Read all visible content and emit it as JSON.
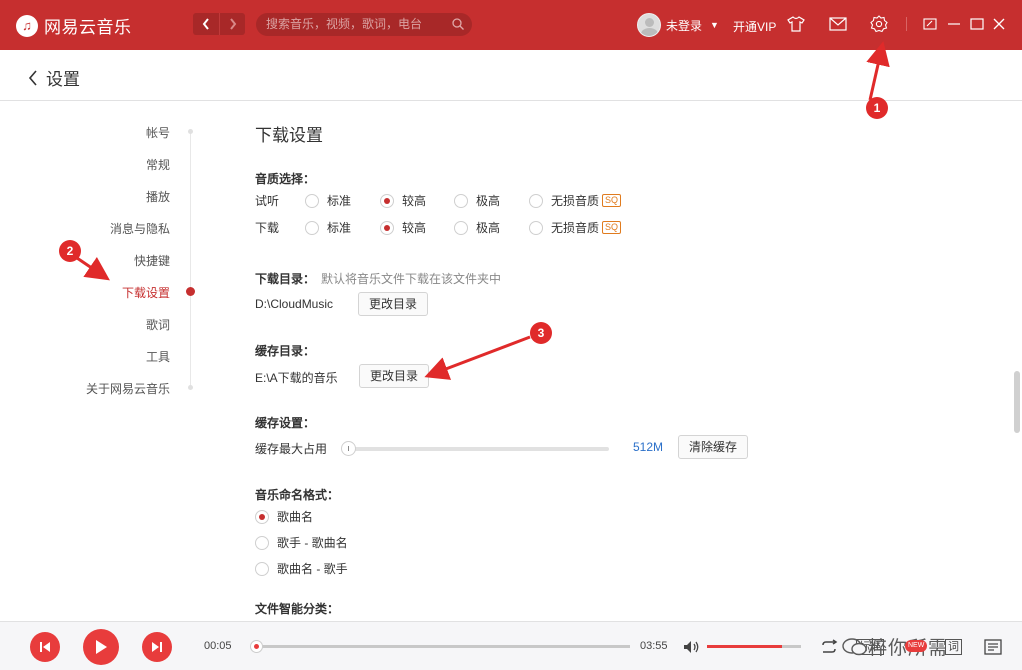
{
  "titlebar": {
    "app_name": "网易云音乐",
    "logo_glyph": "♫",
    "search_placeholder": "搜索音乐，视频，歌词，电台",
    "user_name": "未登录",
    "vip_label": "开通VIP",
    "accent_color": "#c62f2f"
  },
  "header": {
    "title": "设置",
    "back_glyph": "‹"
  },
  "sidebar": {
    "items": [
      {
        "label": "帐号"
      },
      {
        "label": "常规"
      },
      {
        "label": "播放"
      },
      {
        "label": "消息与隐私"
      },
      {
        "label": "快捷键"
      },
      {
        "label": "下载设置",
        "active": true
      },
      {
        "label": "歌词"
      },
      {
        "label": "工具"
      },
      {
        "label": "关于网易云音乐"
      }
    ]
  },
  "main": {
    "heading": "下载设置",
    "quality": {
      "label": "音质选择：",
      "rows": [
        {
          "label": "试听",
          "options": [
            "标准",
            "较高",
            "极高",
            "无损音质"
          ],
          "selected": 1
        },
        {
          "label": "下载",
          "options": [
            "标准",
            "较高",
            "极高",
            "无损音质"
          ],
          "selected": 1
        }
      ],
      "sq_badge": "SQ"
    },
    "download_dir": {
      "label": "下载目录：",
      "hint": "默认将音乐文件下载在该文件夹中",
      "path": "D:\\CloudMusic",
      "button": "更改目录"
    },
    "cache_dir": {
      "label": "缓存目录：",
      "path": "E:\\A下载的音乐",
      "button": "更改目录"
    },
    "cache_settings": {
      "label": "缓存设置：",
      "max_label": "缓存最大占用",
      "value": "512M",
      "slider_fraction": 0.0,
      "clear_button": "清除缓存"
    },
    "naming": {
      "label": "音乐命名格式：",
      "options": [
        "歌曲名",
        "歌手 - 歌曲名",
        "歌曲名 - 歌手"
      ],
      "selected": 0
    },
    "smart_classify": {
      "label": "文件智能分类："
    }
  },
  "annotations": [
    "1",
    "2",
    "3"
  ],
  "player": {
    "elapsed": "00:05",
    "duration": "03:55",
    "progress_fraction": 0.02,
    "volume_fraction": 0.8,
    "quality_label": "标准",
    "new_badge": "NEW",
    "lyrics_label": "词",
    "watermark": "粹你所需"
  }
}
